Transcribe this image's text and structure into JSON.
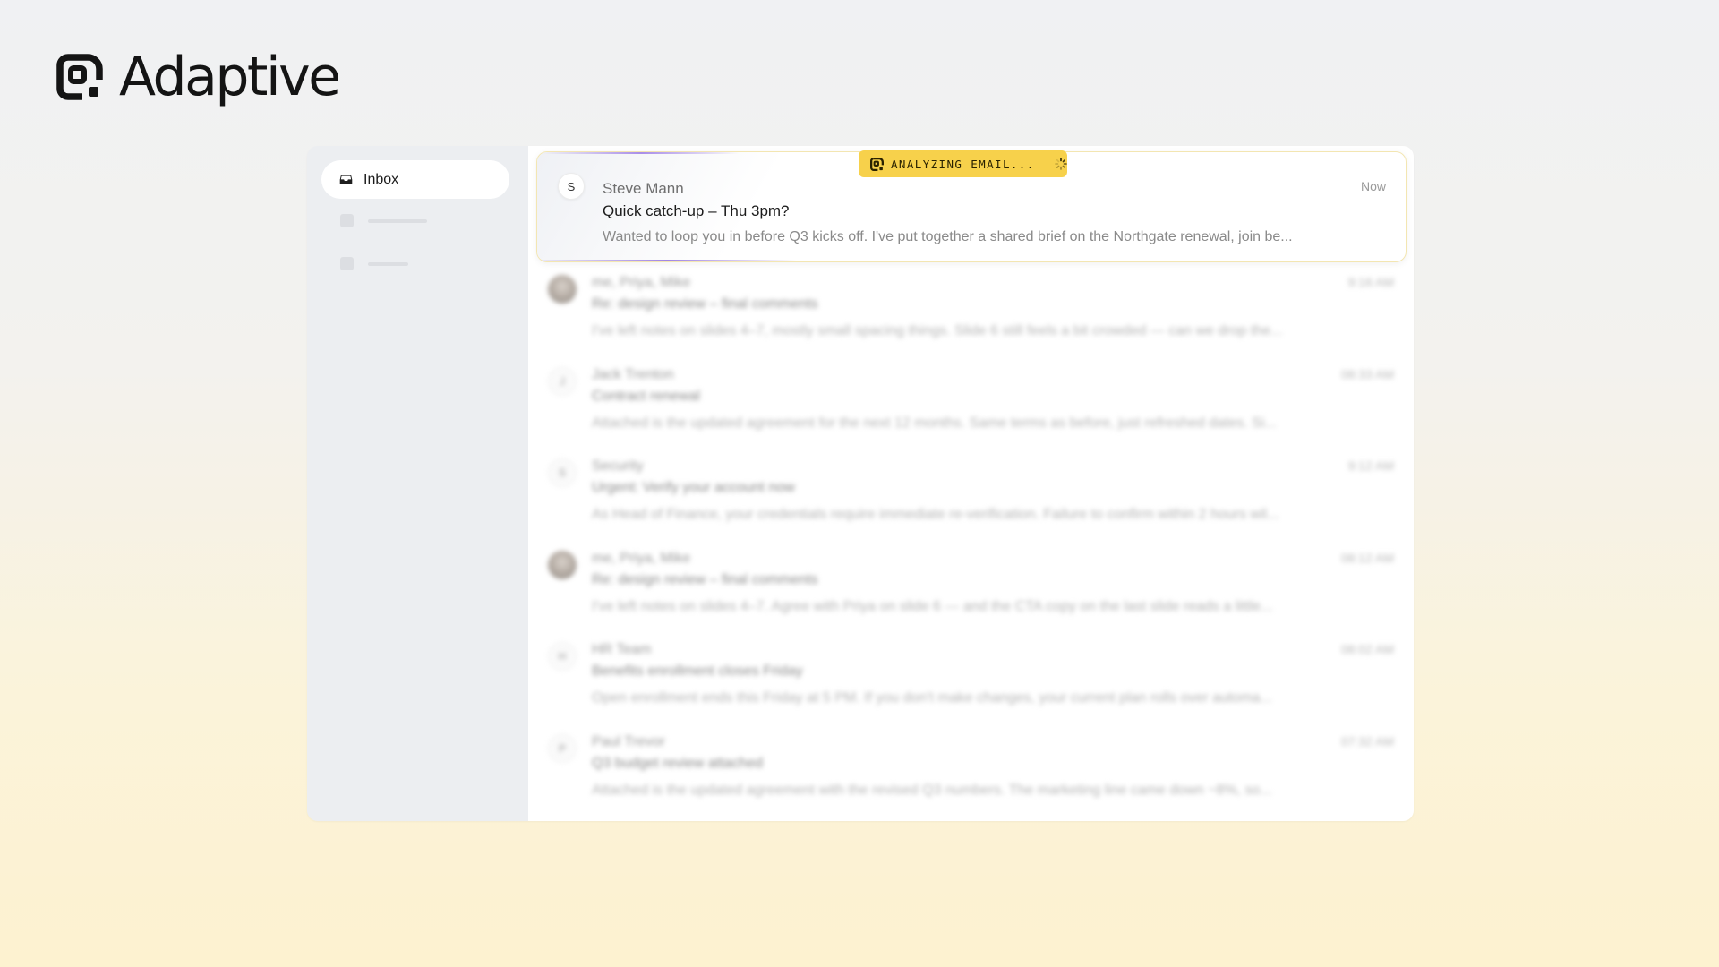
{
  "brand": {
    "name": "Adaptive",
    "icon": "adaptive-logo-icon"
  },
  "sidebar": {
    "inbox": {
      "label": "Inbox",
      "icon": "inbox-tray-icon"
    },
    "placeholders": 2
  },
  "analyzing_badge": {
    "text": "ANALYZING EMAIL...",
    "color": "#f7d14b",
    "icon": "loading-spinner-icon"
  },
  "active_email": {
    "avatar_letter": "S",
    "sender": "Steve Mann",
    "subject": "Quick catch-up – Thu 3pm?",
    "preview": "Wanted to loop you in before Q3 kicks off. I've put together a shared brief on the Northgate renewal, join be...",
    "time": "Now"
  },
  "emails": [
    {
      "avatar": "photo",
      "sender": "me, Priya, Mike",
      "subject": "Re: design review – final comments",
      "preview": "I've left notes on slides 4–7, mostly small spacing things. Slide 6 still feels a bit crowded — can we drop the...",
      "time": "9:16 AM"
    },
    {
      "avatar": "J",
      "sender": "Jack Trenton",
      "subject": "Contract renewal",
      "preview": "Attached is the updated agreement for the next 12 months. Same terms as before, just refreshed dates. Si...",
      "time": "08:33 AM"
    },
    {
      "avatar": "S",
      "sender": "Security",
      "subject": "Urgent: Verify your account now",
      "preview": "As Head of Finance, your credentials require immediate re-verification. Failure to confirm within 2 hours wil...",
      "time": "9:12 AM"
    },
    {
      "avatar": "photo",
      "sender": "me, Priya, Mike",
      "subject": "Re: design review – final comments",
      "preview": "I've left notes on slides 4–7. Agree with Priya on slide 6 — and the CTA copy on the last slide reads a little...",
      "time": "08:12 AM"
    },
    {
      "avatar": "H",
      "sender": "HR Team",
      "subject": "Benefits enrollment closes Friday",
      "preview": "Open enrollment ends this Friday at 5 PM. If you don't make changes, your current plan rolls over automa...",
      "time": "08:02 AM"
    },
    {
      "avatar": "P",
      "sender": "Paul Trevor",
      "subject": "Q3 budget review attached",
      "preview": "Attached is the updated agreement with the revised Q3 numbers. The marketing line came down ~8%, so...",
      "time": "07:32 AM"
    }
  ]
}
